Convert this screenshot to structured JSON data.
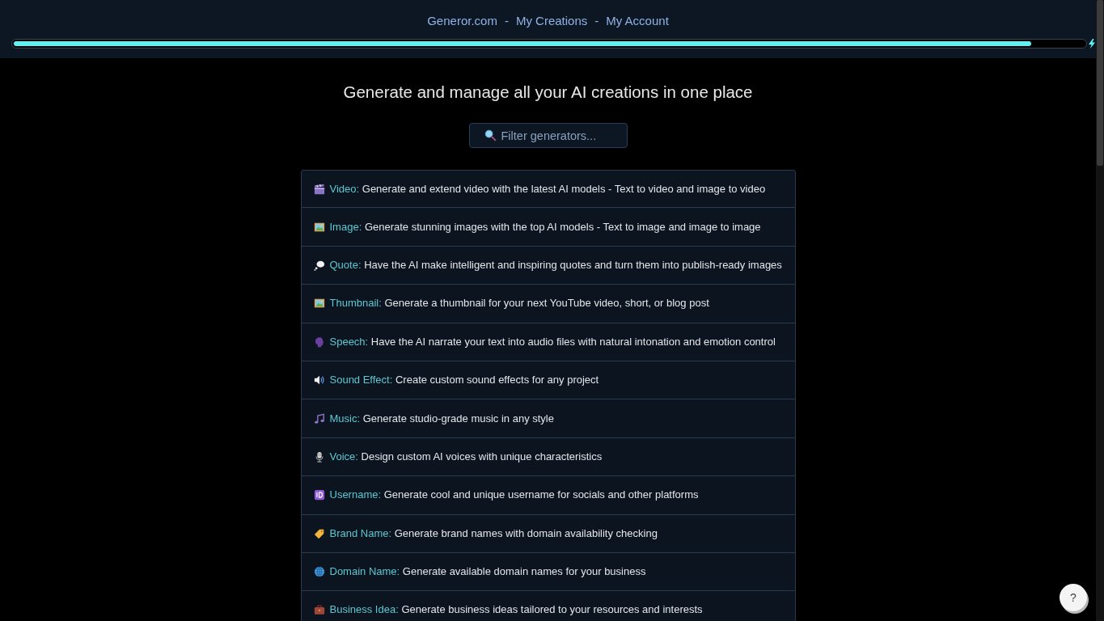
{
  "nav": {
    "links": [
      {
        "label": "Generor.com"
      },
      {
        "label": "My Creations"
      },
      {
        "label": "My Account"
      }
    ],
    "separators": [
      "-",
      "-"
    ]
  },
  "progress": {
    "level": 0.95
  },
  "heading": "Generate and manage all your AI creations in one place",
  "filter": {
    "placeholder": "Filter generators..."
  },
  "generators": [
    {
      "kind": "clapperboard",
      "label": "Video:",
      "description": "Generate and extend video with the latest AI models - Text to video and image to video"
    },
    {
      "kind": "picture",
      "label": "Image:",
      "description": "Generate stunning images with the top AI models - Text to image and image to image"
    },
    {
      "kind": "thought",
      "label": "Quote:",
      "description": "Have the AI make intelligent and inspiring quotes and turn them into publish-ready images"
    },
    {
      "kind": "picture",
      "label": "Thumbnail:",
      "description": "Generate a thumbnail for your next YouTube video, short, or blog post"
    },
    {
      "kind": "head",
      "label": "Speech:",
      "description": "Have the AI narrate your text into audio files with natural intonation and emotion control"
    },
    {
      "kind": "speaker",
      "label": "Sound Effect:",
      "description": "Create custom sound effects for any project"
    },
    {
      "kind": "notes",
      "label": "Music:",
      "description": "Generate studio-grade music in any style"
    },
    {
      "kind": "microphone",
      "label": "Voice:",
      "description": "Design custom AI voices with unique characteristics"
    },
    {
      "kind": "id",
      "label": "Username:",
      "description": "Generate cool and unique username for socials and other platforms"
    },
    {
      "kind": "tag",
      "label": "Brand Name:",
      "description": "Generate brand names with domain availability checking"
    },
    {
      "kind": "globe",
      "label": "Domain Name:",
      "description": "Generate available domain names for your business"
    },
    {
      "kind": "briefcase",
      "label": "Business Idea:",
      "description": "Generate business ideas tailored to your resources and interests"
    }
  ],
  "help_button": {
    "label": "?"
  }
}
